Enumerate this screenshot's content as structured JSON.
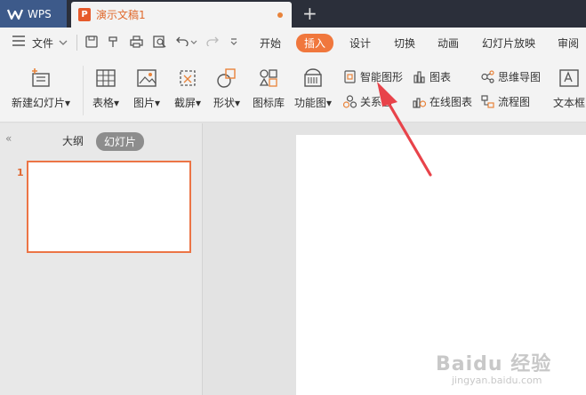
{
  "titlebar": {
    "app_label": "WPS",
    "doc_name": "演示文稿1",
    "doc_icon_letter": "P",
    "new_tab": "+"
  },
  "menubar": {
    "file_label": "文件",
    "menus": [
      "开始",
      "插入",
      "设计",
      "切换",
      "动画",
      "幻灯片放映",
      "审阅"
    ],
    "active_menu": "插入"
  },
  "ribbon": {
    "new_slide": "新建幻灯片",
    "table": "表格",
    "picture": "图片",
    "screenshot": "截屏",
    "shape": "形状",
    "icon_lib": "图标库",
    "function_chart": "功能图",
    "smart_art": "智能图形",
    "relation": "关系图",
    "chart": "图表",
    "online_chart": "在线图表",
    "mindmap": "思维导图",
    "flowchart": "流程图",
    "textbox": "文本框"
  },
  "leftpanel": {
    "collapse": "«",
    "tab_outline": "大纲",
    "tab_slides": "幻灯片",
    "slide_number": "1"
  },
  "watermark": {
    "line1": "Baidu 经验",
    "line2": "jingyan.baidu.com"
  },
  "colors": {
    "accent": "#f0773d",
    "titlebar": "#2b2f3a",
    "wps_tab": "#3d5a8a",
    "arrow": "#e8434a"
  }
}
